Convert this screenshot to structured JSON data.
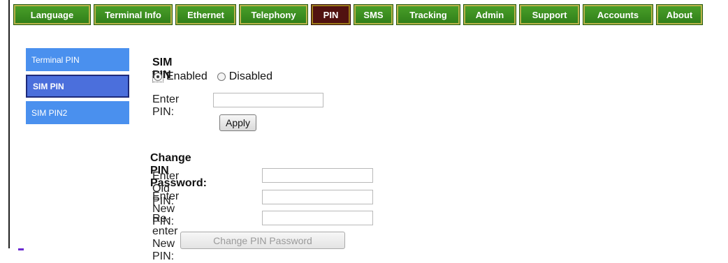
{
  "nav": {
    "tabs": [
      {
        "label": "Language"
      },
      {
        "label": "Terminal Info"
      },
      {
        "label": "Ethernet"
      },
      {
        "label": "Telephony"
      },
      {
        "label": "PIN"
      },
      {
        "label": "SMS"
      },
      {
        "label": "Tracking"
      },
      {
        "label": "Admin"
      },
      {
        "label": "Support"
      },
      {
        "label": "Accounts"
      },
      {
        "label": "About"
      }
    ],
    "active_tab": "PIN"
  },
  "sidebar": {
    "items": [
      {
        "label": "Terminal PIN"
      },
      {
        "label": "SIM PIN"
      },
      {
        "label": "SIM PIN2"
      }
    ],
    "active_item": "SIM PIN"
  },
  "sim_pin": {
    "title": "SIM PIN",
    "enabled_label": "Enabled",
    "disabled_label": "Disabled",
    "selected": "Enabled",
    "enter_pin_label": "Enter PIN:",
    "pin_value": "",
    "apply_label": "Apply"
  },
  "change_pin": {
    "title": "Change PIN Password:",
    "old_label": "Enter Old PIN:",
    "new_label": "Enter New PIN:",
    "reenter_label": "Re-enter New PIN:",
    "old_value": "",
    "new_value": "",
    "reenter_value": "",
    "button_label": "Change PIN Password"
  },
  "colors": {
    "tab_green": "#3f8f22",
    "tab_active": "#511210",
    "sidebar_blue": "#4a90ee",
    "sidebar_active": "#4b6fdc"
  }
}
